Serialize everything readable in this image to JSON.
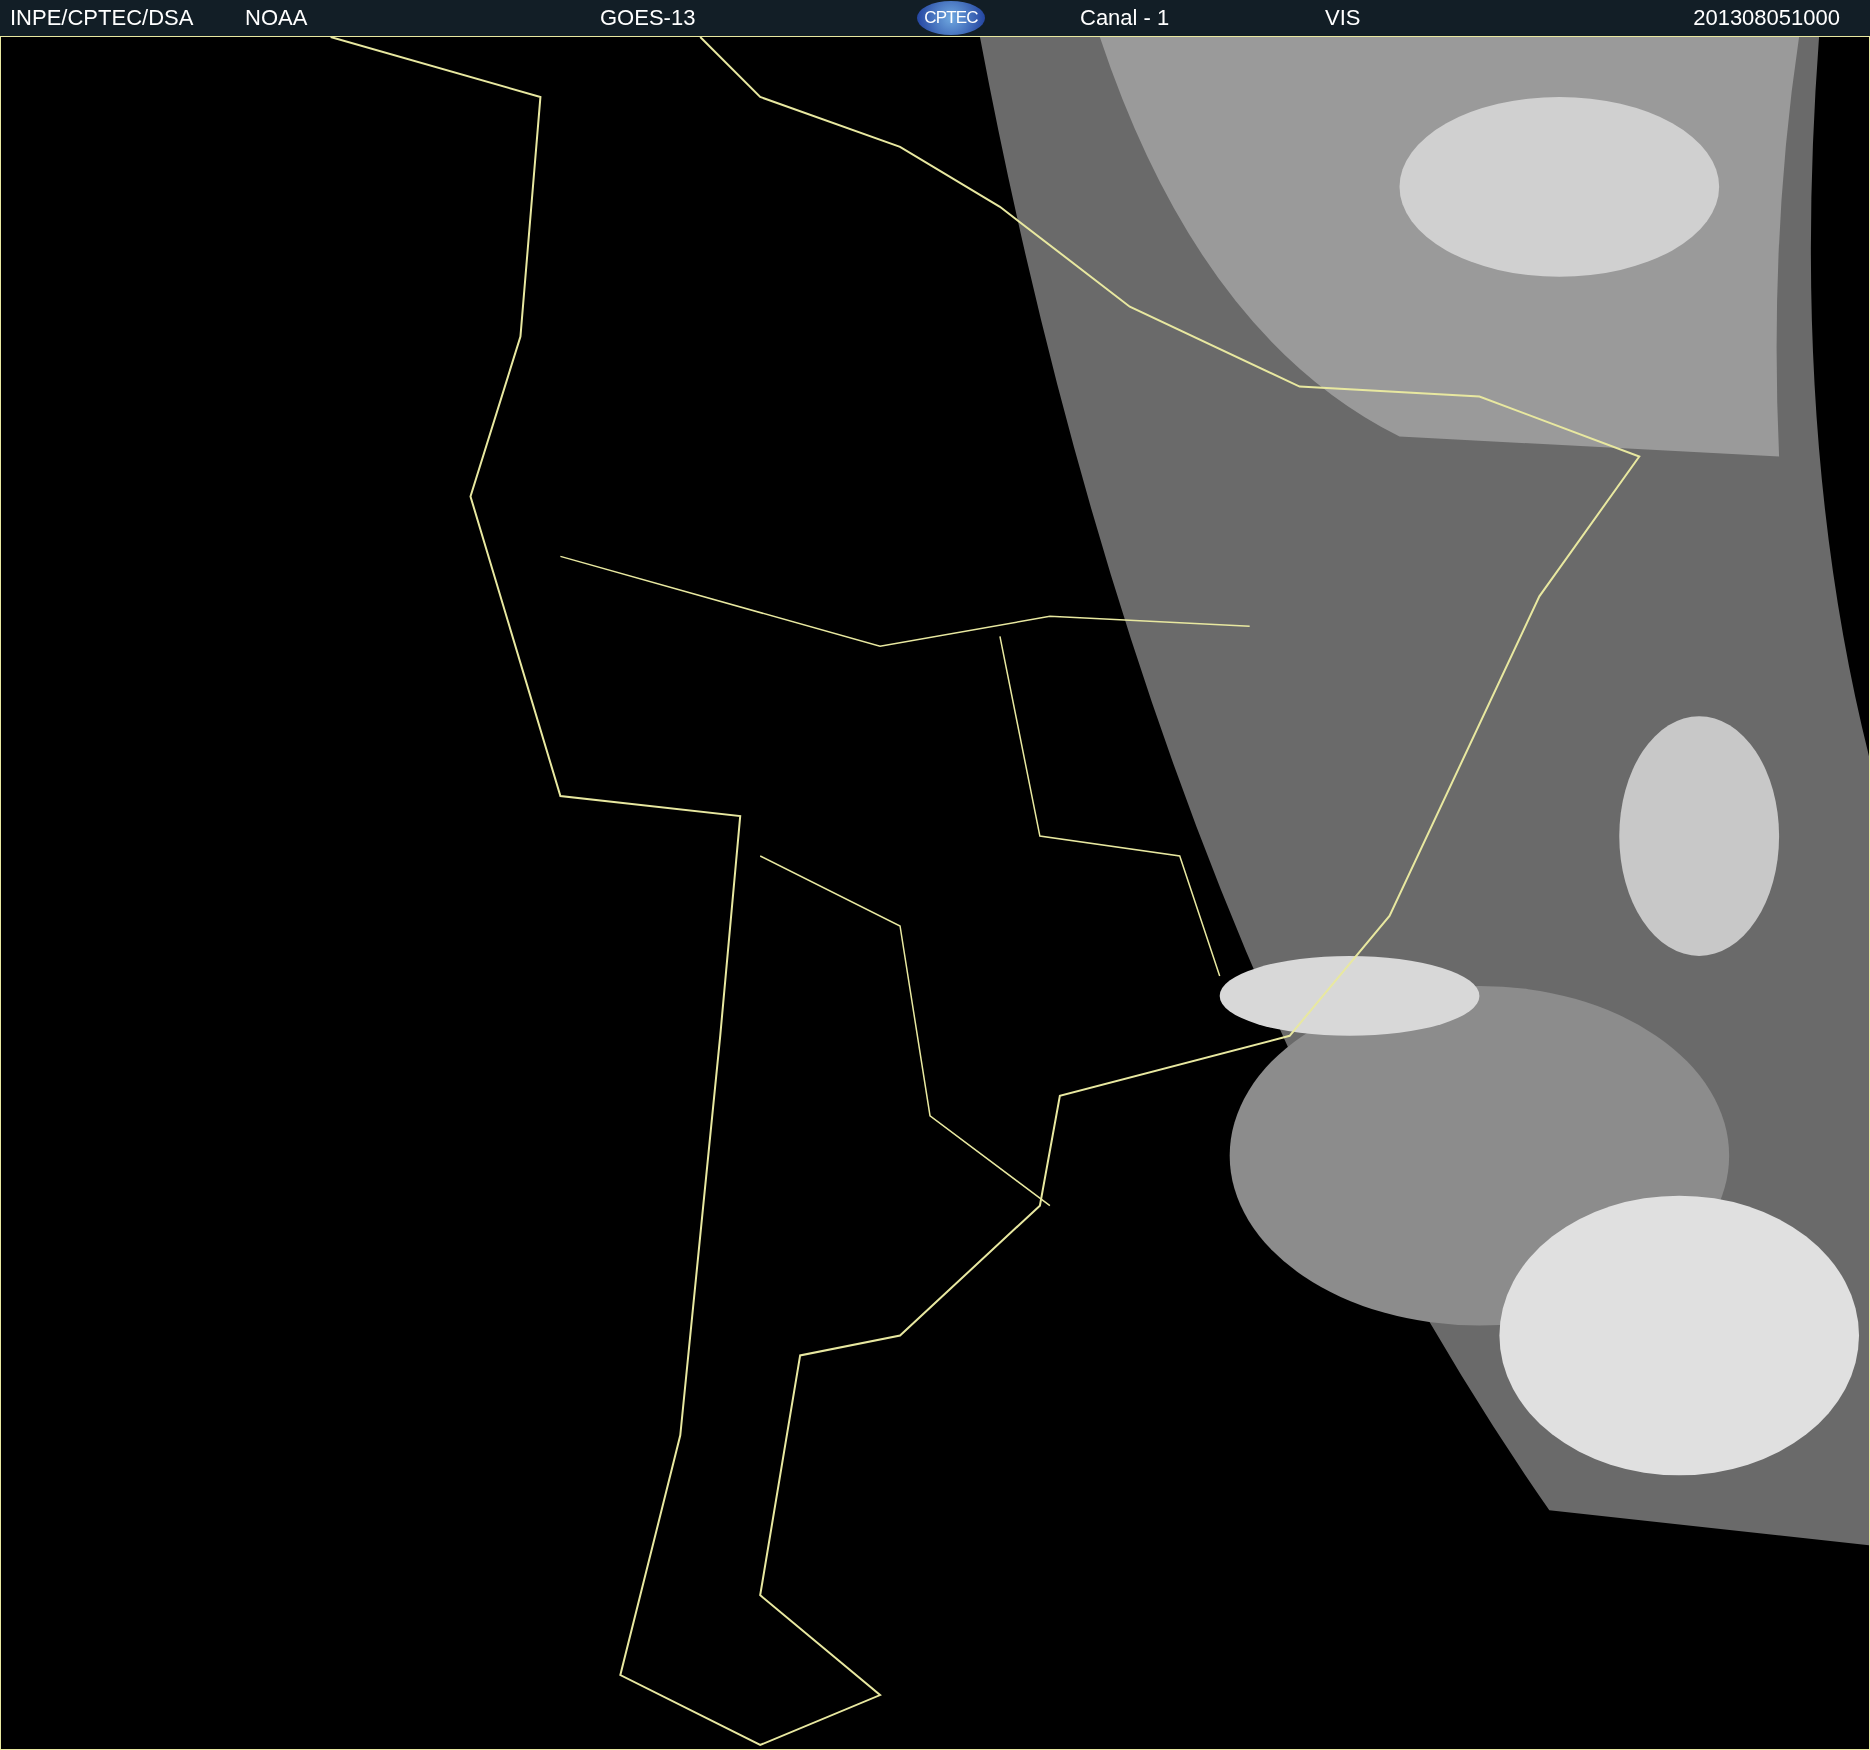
{
  "header": {
    "source": "INPE/CPTEC/DSA",
    "agency": "NOAA",
    "satellite": "GOES-13",
    "logo_text": "CPTEC",
    "channel": "Canal - 1",
    "band": "VIS",
    "timestamp": "201308051000"
  }
}
